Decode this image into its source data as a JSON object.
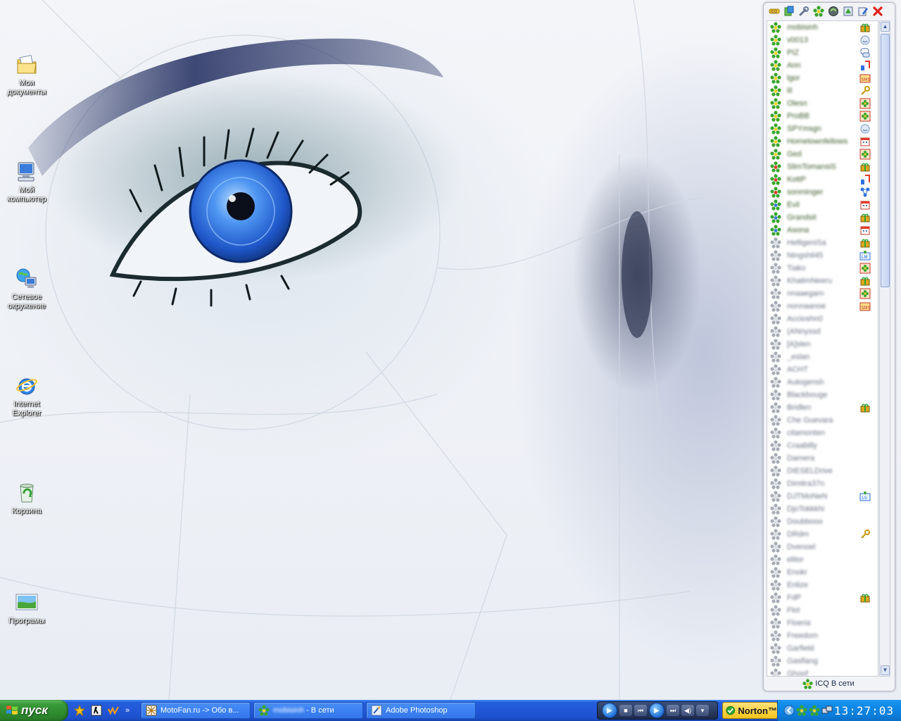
{
  "desktop": {
    "icons": [
      {
        "label": "Мои документы",
        "icon": "my-documents-icon"
      },
      {
        "label": "Мой компьютер",
        "icon": "my-computer-icon"
      },
      {
        "label": "Сетевое окружение",
        "icon": "network-places-icon"
      },
      {
        "label": "Internet Explorer",
        "icon": "internet-explorer-icon"
      },
      {
        "label": "Корзина",
        "icon": "recycle-bin-icon"
      },
      {
        "label": "Програмы",
        "icon": "programs-icon"
      }
    ]
  },
  "icq": {
    "toolbar_icons": [
      "icq-menu-icon",
      "users-icon",
      "settings-icon",
      "icq-flower-icon",
      "sound-icon",
      "status-icon",
      "config-icon",
      "close-icon"
    ],
    "status_label": "ICQ В сети",
    "contacts": [
      {
        "name": "mobisinh",
        "status": "online",
        "xstatus": "gift"
      },
      {
        "name": "v0013",
        "status": "online",
        "xstatus": "smile"
      },
      {
        "name": "PIZ",
        "status": "online",
        "xstatus": "chat"
      },
      {
        "name": "Ann",
        "status": "online",
        "xstatus": "music"
      },
      {
        "name": "lgor",
        "status": "online",
        "xstatus": "sms"
      },
      {
        "name": "lil",
        "status": "online",
        "xstatus": "key"
      },
      {
        "name": "Olesn",
        "status": "online",
        "xstatus": "flower"
      },
      {
        "name": "ProBB",
        "status": "online",
        "xstatus": "flower"
      },
      {
        "name": "SPYmsgn",
        "status": "online",
        "xstatus": "smile"
      },
      {
        "name": "Hometownfellows",
        "status": "online",
        "xstatus": "calendar"
      },
      {
        "name": "Ged",
        "status": "online",
        "xstatus": "flower"
      },
      {
        "name": "SlimTomansiS",
        "status": "online-free",
        "xstatus": "gift"
      },
      {
        "name": "KottP",
        "status": "online-free",
        "xstatus": "music"
      },
      {
        "name": "sonminger",
        "status": "online-free",
        "xstatus": "net"
      },
      {
        "name": "Evil",
        "status": "away",
        "xstatus": "calendar"
      },
      {
        "name": "Grandsit",
        "status": "away",
        "xstatus": "gift"
      },
      {
        "name": "Asona",
        "status": "away",
        "xstatus": "calendar"
      },
      {
        "name": "HelligeniSa",
        "status": "offline",
        "xstatus": "gift"
      },
      {
        "name": "Ningshil45",
        "status": "offline",
        "xstatus": "lm"
      },
      {
        "name": "Tiako",
        "status": "offline",
        "xstatus": "flower"
      },
      {
        "name": "KhatimNeeru",
        "status": "offline",
        "xstatus": "gift"
      },
      {
        "name": "nnaaegarn",
        "status": "offline",
        "xstatus": "flower"
      },
      {
        "name": "nonnaanoe",
        "status": "offline",
        "xstatus": "sms"
      },
      {
        "name": "Accioshn0",
        "status": "offline",
        "xstatus": ""
      },
      {
        "name": "(ANnyssd",
        "status": "offline",
        "xstatus": ""
      },
      {
        "name": "[A]slen",
        "status": "offline",
        "xstatus": ""
      },
      {
        "name": "_eslan",
        "status": "offline",
        "xstatus": ""
      },
      {
        "name": "ACHT",
        "status": "offline",
        "xstatus": ""
      },
      {
        "name": "Autogensh",
        "status": "offline",
        "xstatus": ""
      },
      {
        "name": "Blackbouge",
        "status": "offline",
        "xstatus": ""
      },
      {
        "name": "Bridlen",
        "status": "offline",
        "xstatus": "gift"
      },
      {
        "name": "Che Guevara",
        "status": "offline",
        "xstatus": ""
      },
      {
        "name": "citamonten",
        "status": "offline",
        "xstatus": ""
      },
      {
        "name": "Craabilly",
        "status": "offline",
        "xstatus": ""
      },
      {
        "name": "Damera",
        "status": "offline",
        "xstatus": ""
      },
      {
        "name": "DIESELDrive",
        "status": "offline",
        "xstatus": ""
      },
      {
        "name": "Dimitra37n",
        "status": "offline",
        "xstatus": ""
      },
      {
        "name": "DJTMoNeN",
        "status": "offline",
        "xstatus": "ls"
      },
      {
        "name": "DjoTokkkhi",
        "status": "offline",
        "xstatus": ""
      },
      {
        "name": "Doubbooo",
        "status": "offline",
        "xstatus": ""
      },
      {
        "name": "DRdm",
        "status": "offline",
        "xstatus": "key"
      },
      {
        "name": "Dvenoel",
        "status": "offline",
        "xstatus": ""
      },
      {
        "name": "elitor",
        "status": "offline",
        "xstatus": ""
      },
      {
        "name": "Enokr",
        "status": "offline",
        "xstatus": ""
      },
      {
        "name": "Enlize",
        "status": "offline",
        "xstatus": ""
      },
      {
        "name": "FdP",
        "status": "offline",
        "xstatus": "gift"
      },
      {
        "name": "Flot",
        "status": "offline",
        "xstatus": ""
      },
      {
        "name": "Floeria",
        "status": "offline",
        "xstatus": ""
      },
      {
        "name": "Freedom",
        "status": "offline",
        "xstatus": ""
      },
      {
        "name": "Garfield",
        "status": "offline",
        "xstatus": ""
      },
      {
        "name": "Gasflang",
        "status": "offline",
        "xstatus": ""
      },
      {
        "name": "Ghoof",
        "status": "offline",
        "xstatus": ""
      }
    ]
  },
  "taskbar": {
    "start_label": "пуск",
    "quick_launch_more": "»",
    "tasks": [
      {
        "label": "MotoFan.ru -> Обо в...",
        "icon": "motofan-icon"
      },
      {
        "label_blurred": "mobisinh",
        "label": " - В сети",
        "icon": "icq-flower-icon"
      },
      {
        "label": "Adobe Photoshop",
        "icon": "photoshop-icon"
      }
    ],
    "norton_label": "Norton™",
    "clock": "13:27:03"
  },
  "colors": {
    "taskbar_blue": "#245edb",
    "start_green": "#3a9c3a",
    "tray_blue": "#0f8ae9",
    "icq_online_green": "#4db82e",
    "eye_blue": "#2f6fe0"
  }
}
